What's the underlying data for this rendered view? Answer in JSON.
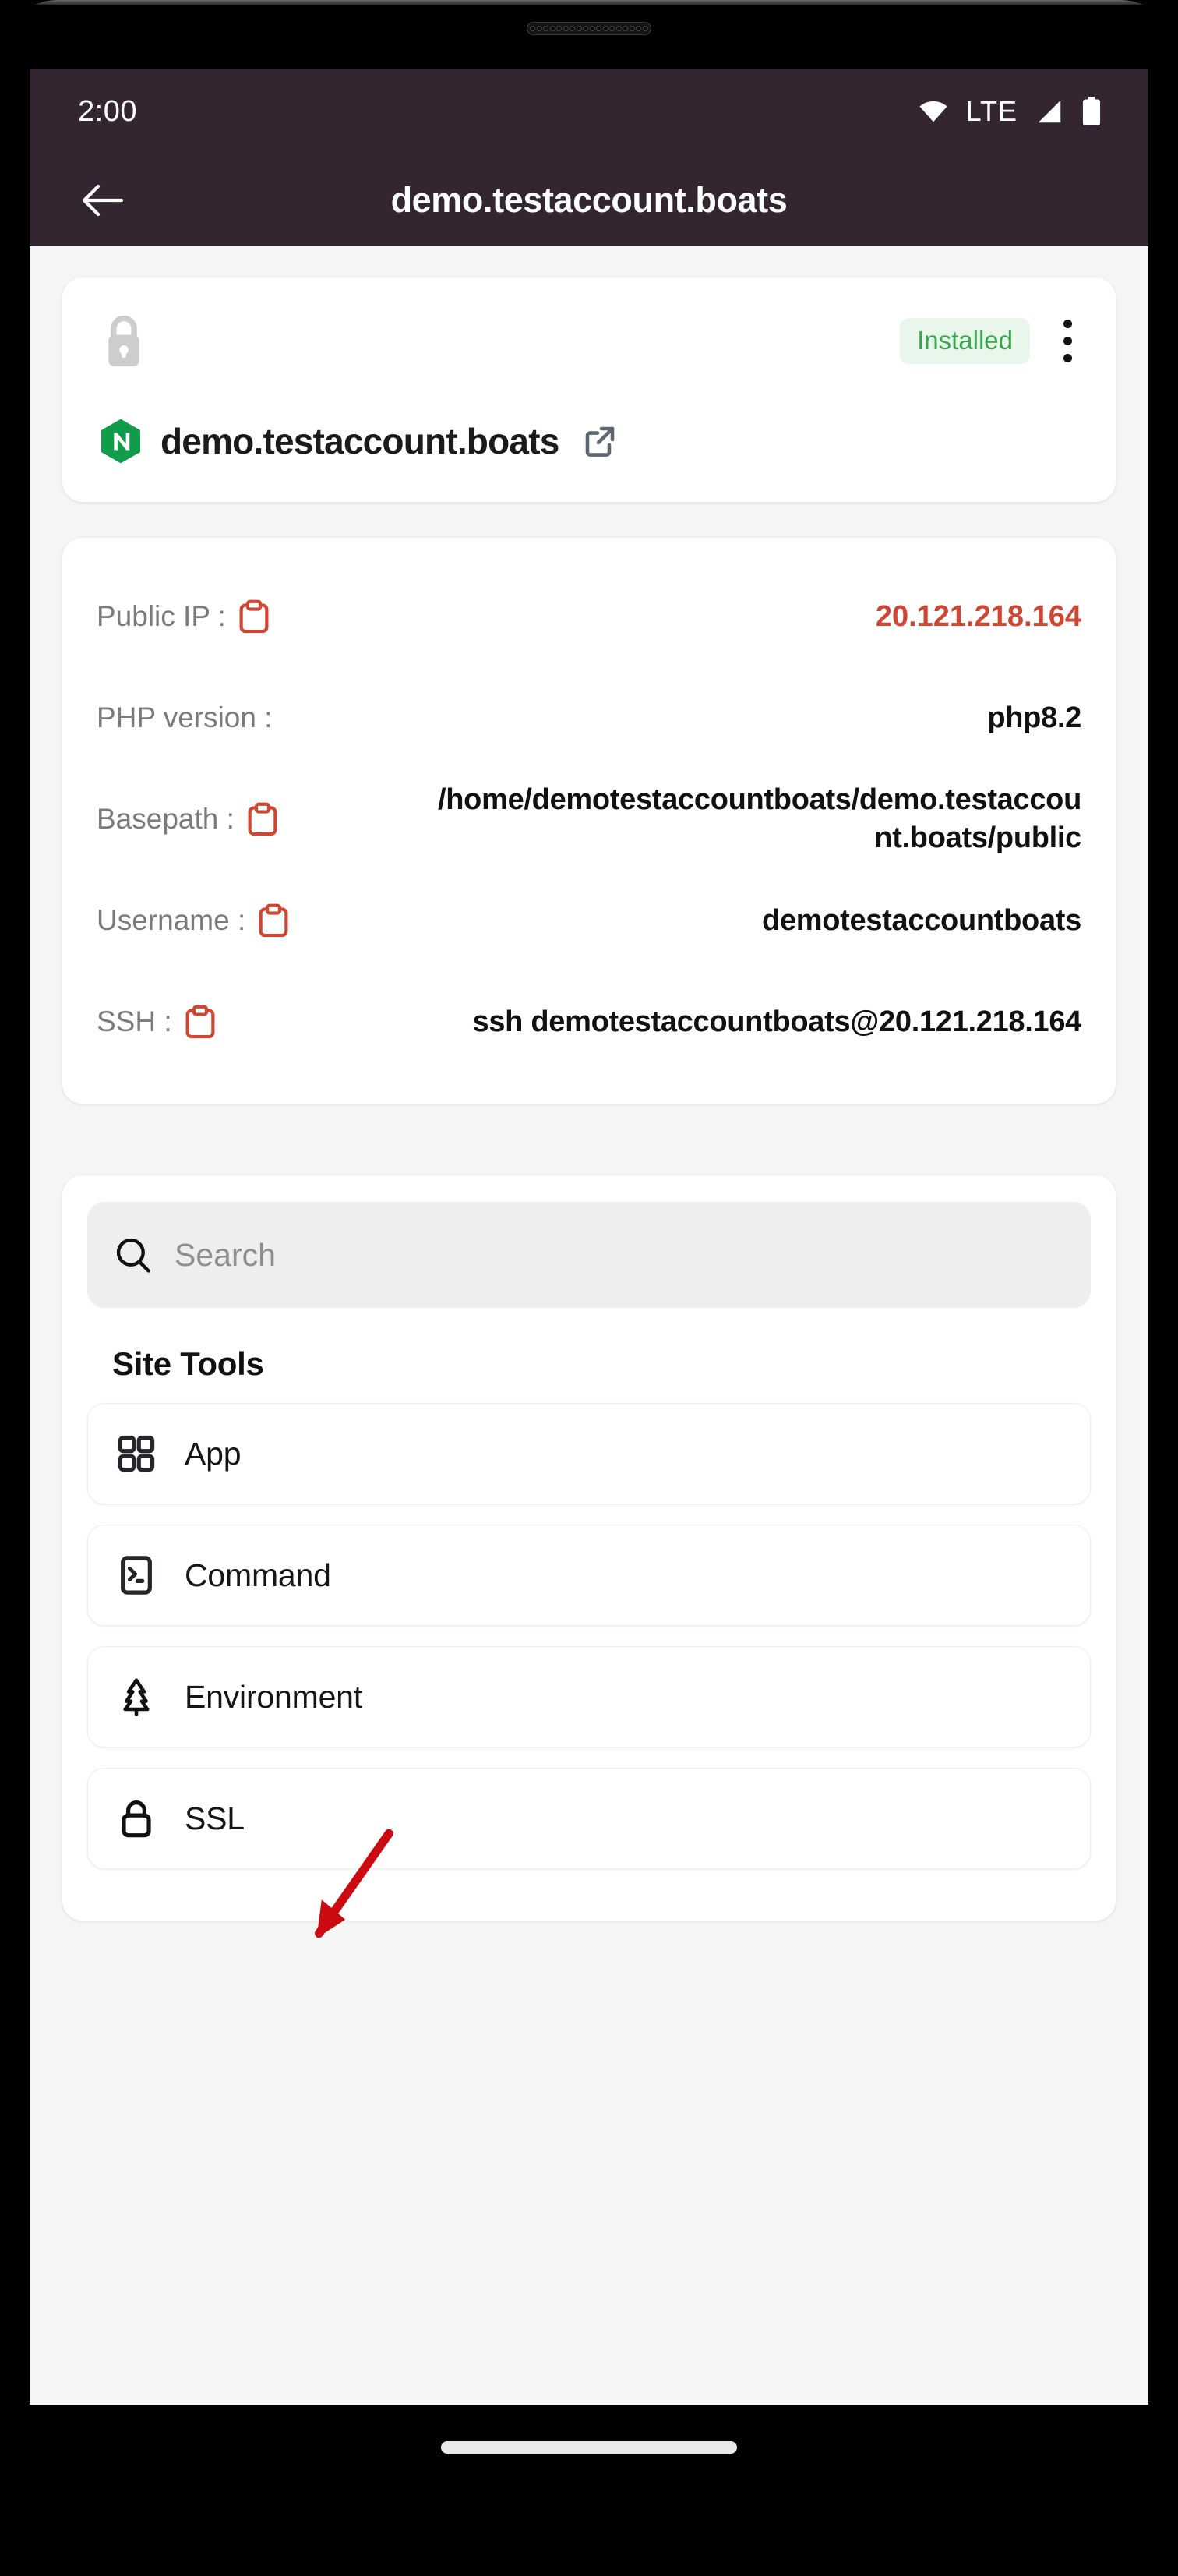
{
  "status_bar": {
    "time": "2:00",
    "network_label": "LTE",
    "icons": [
      "wifi-icon",
      "signal-icon",
      "battery-icon"
    ]
  },
  "app_bar": {
    "back_icon": "arrow-left-icon",
    "title": "demo.testaccount.boats"
  },
  "site_card": {
    "lock_icon": "lock-icon",
    "status_badge": "Installed",
    "menu_icon": "kebab-menu-icon",
    "server_icon": "nginx-logo",
    "domain": "demo.testaccount.boats",
    "open_icon": "external-link-icon"
  },
  "info_card": {
    "rows": [
      {
        "label": "Public IP :",
        "value": "20.121.218.164",
        "copy": true,
        "accent": true
      },
      {
        "label": "PHP version :",
        "value": "php8.2",
        "copy": false,
        "accent": false
      },
      {
        "label": "Basepath :",
        "value": "/home/demotestaccountboats/demo.testaccount.boats/public",
        "copy": true,
        "accent": false
      },
      {
        "label": "Username :",
        "value": "demotestaccountboats",
        "copy": true,
        "accent": false
      },
      {
        "label": "SSH :",
        "value": "ssh demotestaccountboats@20.121.218.164",
        "copy": true,
        "accent": false
      }
    ]
  },
  "search": {
    "icon": "search-icon",
    "placeholder": "Search",
    "value": ""
  },
  "site_tools": {
    "heading": "Site Tools",
    "items": [
      {
        "label": "App",
        "icon": "grid-apps-icon"
      },
      {
        "label": "Command",
        "icon": "terminal-icon"
      },
      {
        "label": "Environment",
        "icon": "tree-icon"
      },
      {
        "label": "SSL",
        "icon": "lock-icon"
      }
    ]
  },
  "annotation": {
    "type": "arrow",
    "color": "#cc0a12",
    "points_to": "App"
  },
  "colors": {
    "app_bar": "#342630",
    "page_background": "#f5f5f5",
    "card": "#ffffff",
    "accent_red": "#cf4632",
    "badge_text": "#3aa750",
    "badge_background": "#e9f6ec",
    "nginx_green": "#119c4b"
  }
}
